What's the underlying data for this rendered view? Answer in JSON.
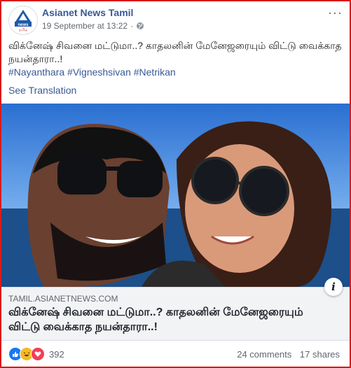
{
  "post": {
    "page_name": "Asianet News Tamil",
    "timestamp": "19 September at 13:22",
    "separator": "·",
    "more_label": "···",
    "text": "விக்னேஷ் சிவனை மட்டுமா..? காதலனின் மேனேஜரையும் விட்டு வைக்காத நயன்தாரா..!",
    "hashtags": "#Nayanthara #Vigneshsivan #Netrikan",
    "see_translation": "See Translation"
  },
  "avatar": {
    "brand_text": "news",
    "sub_text": "தமிழ்"
  },
  "link_preview": {
    "domain": "TAMIL.ASIANETNEWS.COM",
    "headline": "விக்னேஷ் சிவனை மட்டுமா..? காதலனின் மேனேஜரையும் விட்டு வைக்காத நயன்தாரா..!",
    "info_label": "i"
  },
  "footer": {
    "reaction_count": "392",
    "comments": "24 comments",
    "shares": "17 shares"
  },
  "colors": {
    "border": "#d81b1b",
    "link": "#385898",
    "like": "#1877f2",
    "haha": "#f7b928",
    "love": "#f33e58"
  }
}
